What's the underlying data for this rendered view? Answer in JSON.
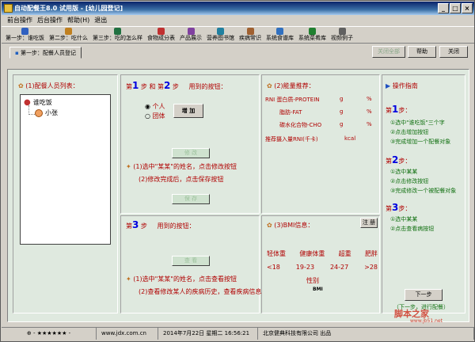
{
  "window": {
    "title": "自动配餐王8.0 试用版 - [幼儿园登记]"
  },
  "menu": [
    "前台操作",
    "后台操作",
    "帮助(H)",
    "退出"
  ],
  "toolbar": [
    {
      "label": "第一步：谁吃饭",
      "color": "#3060c0"
    },
    {
      "label": "第二步：吃什么",
      "color": "#c08020"
    },
    {
      "label": "第三步：吃的怎么样",
      "color": "#207040"
    },
    {
      "label": "食物成分表",
      "color": "#c03030"
    },
    {
      "label": "产品展示",
      "color": "#8040a0"
    },
    {
      "label": "营养图书馆",
      "color": "#2080a0"
    },
    {
      "label": "疾病常识",
      "color": "#a06030"
    },
    {
      "label": "系统食谱库",
      "color": "#3070c0"
    },
    {
      "label": "系统菜肴库",
      "color": "#208030"
    },
    {
      "label": "视频例子",
      "color": "#606060"
    }
  ],
  "tabbar": {
    "tab": "第一步：配餐人员登记",
    "btn_close_all": "关闭全部",
    "btn_help": "帮助",
    "btn_close": "关闭"
  },
  "left": {
    "title": "(1)配餐人员列表：",
    "tree": {
      "root": "谁吃饭",
      "child": "小张"
    }
  },
  "steps12": {
    "prefix": "第",
    "n1": "1",
    "mid": "步 和 第",
    "n2": "2",
    "suffix": "步",
    "hint": "用到的按钮：",
    "radio_person": "个人",
    "radio_group": "团体",
    "btn_add": "增 加",
    "btn_modify": "修 改",
    "tip1": "(1)选中\"某某\"的姓名，点击修改按钮",
    "tip2": "(2)修改完成后，点击保存按钮",
    "btn_save": "保 存"
  },
  "step3": {
    "prefix": "第",
    "n": "3",
    "suffix": "步",
    "hint": "用到的按钮：",
    "btn_view": "查 看",
    "tip1": "(1)选中\"某某\"的姓名，点击查看按钮",
    "tip2": "(2)查看修改某人的疾病历史，查看疾病信息"
  },
  "energy": {
    "title": "(2)能量推荐：",
    "rows": [
      {
        "label": "RNI  蛋白质-PROTEIN",
        "unit": "g",
        "pct": "%"
      },
      {
        "label": "脂肪-FAT",
        "unit": "g",
        "pct": "%"
      },
      {
        "label": "碳水化合物-CHO",
        "unit": "g",
        "pct": "%"
      },
      {
        "label": "推荐摄入量RNI(千卡)",
        "unit": "kcal",
        "pct": ""
      }
    ]
  },
  "bmi": {
    "title": "(3)BMI信息：",
    "btn": "注 册",
    "headers": [
      "轻体重",
      "健康体重",
      "超重",
      "肥胖"
    ],
    "ranges": [
      "<18",
      "19-23",
      "24-27",
      ">28"
    ],
    "gender": "性别",
    "bmi_label": "BMI"
  },
  "guide": {
    "title": "操作指南",
    "s1": {
      "prefix": "第",
      "n": "1",
      "suffix": "步：",
      "items": [
        "①选中\"谁吃饭\"三个字",
        "②点击增加按钮",
        "③完成增加一个配餐对象"
      ]
    },
    "s2": {
      "prefix": "第",
      "n": "2",
      "suffix": "步：",
      "items": [
        "①选中某某",
        "②点击修改按钮",
        "③完成修改一个被配餐对象"
      ]
    },
    "s3": {
      "prefix": "第",
      "n": "3",
      "suffix": "步：",
      "items": [
        "①选中某某",
        "②点击查看病按钮"
      ]
    },
    "btn_next": "下一步",
    "next_tip": "（下一步，进行配餐）"
  },
  "status": [
    "⊕ - ★★★★★★ -",
    "www.jdx.com.cn",
    "2014年7月22日  星期二 16:56:21",
    "北京健典科技有限公司  出品"
  ],
  "watermark": {
    "main": "脚本之家",
    "sub": "www.jb51.net"
  }
}
